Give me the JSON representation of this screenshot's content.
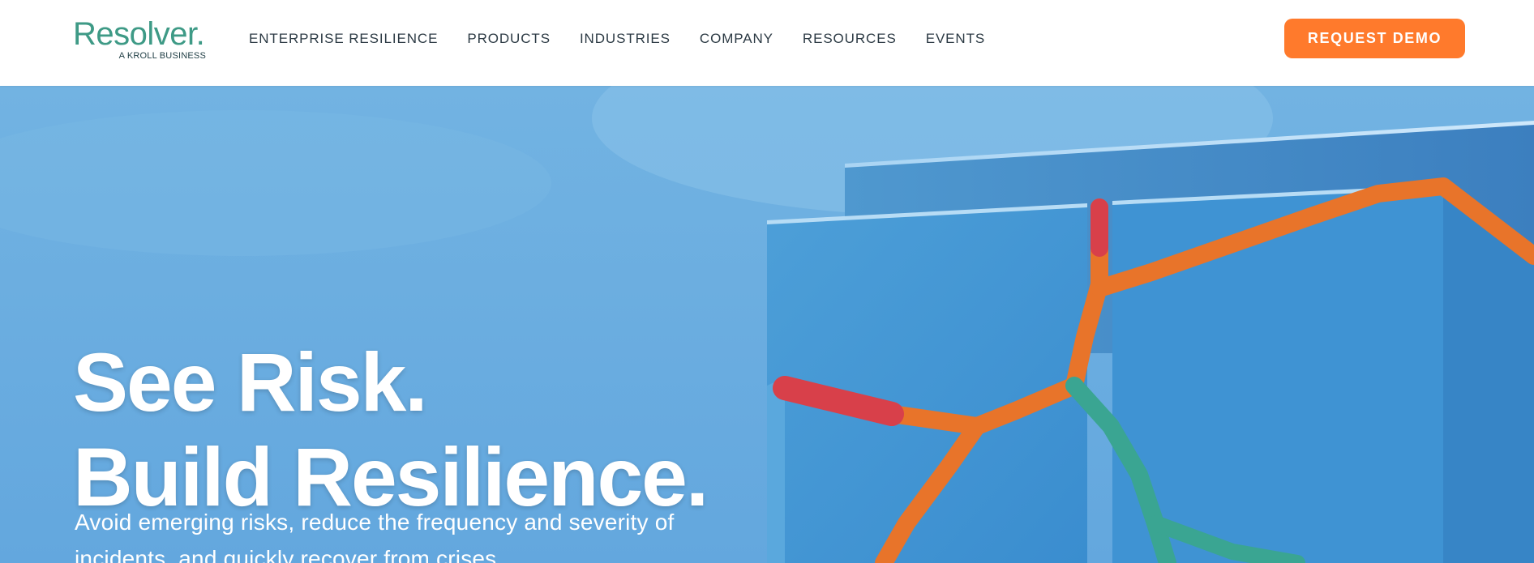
{
  "brand": {
    "logo_word": "Resolver.",
    "logo_sub": "A KROLL BUSINESS",
    "logo_color": "#3e9a86"
  },
  "nav": {
    "items": [
      {
        "label": "ENTERPRISE RESILIENCE"
      },
      {
        "label": "PRODUCTS"
      },
      {
        "label": "INDUSTRIES"
      },
      {
        "label": "COMPANY"
      },
      {
        "label": "RESOURCES"
      },
      {
        "label": "EVENTS"
      }
    ]
  },
  "cta": {
    "label": "REQUEST DEMO",
    "color": "#ff7a2c"
  },
  "hero": {
    "title_line1": "See Risk.",
    "title_line2": "Build Resilience.",
    "description": "Avoid emerging risks, reduce the frequency and severity of incidents, and quickly recover from crises",
    "background_color": "#68ace0",
    "crack_colors": [
      "#e8742a",
      "#d8404a",
      "#3aa592"
    ]
  }
}
